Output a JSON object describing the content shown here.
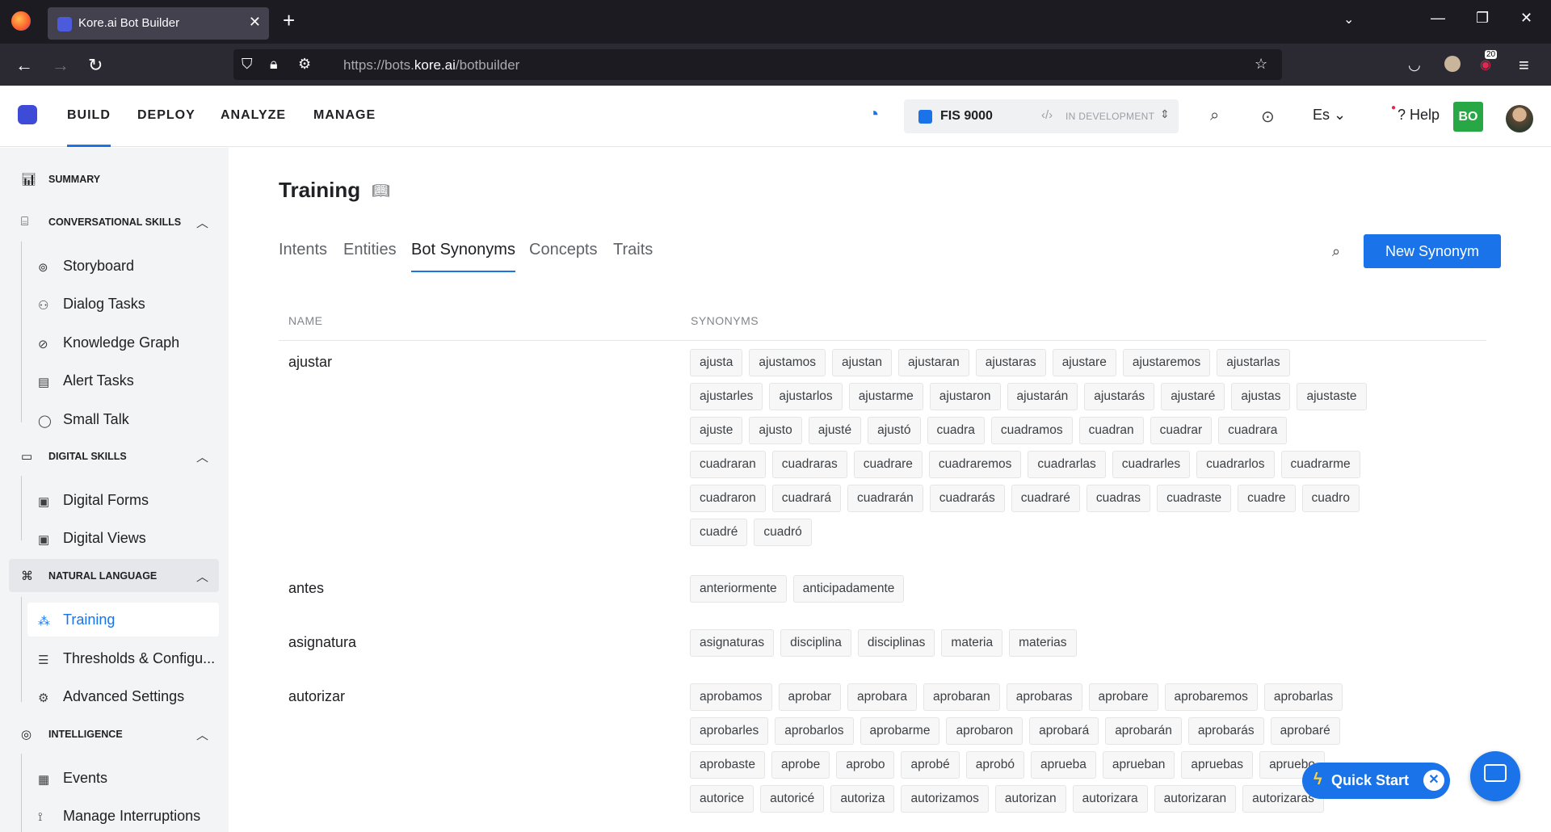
{
  "browser": {
    "tab_title": "Kore.ai Bot Builder",
    "url_prefix": "https://bots.",
    "url_domain": "kore.ai",
    "url_path": "/botbuilder",
    "badge_count": "20"
  },
  "header": {
    "nav": [
      "BUILD",
      "DEPLOY",
      "ANALYZE",
      "MANAGE"
    ],
    "bot_name": "FIS 9000",
    "bot_state": "IN DEVELOPMENT",
    "language": "Es",
    "help": "Help",
    "user_initials": "BO"
  },
  "sidebar": {
    "summary": "SUMMARY",
    "conversational": "CONVERSATIONAL SKILLS",
    "conv_items": [
      "Storyboard",
      "Dialog Tasks",
      "Knowledge Graph",
      "Alert Tasks",
      "Small Talk"
    ],
    "digital": "DIGITAL SKILLS",
    "digital_items": [
      "Digital Forms",
      "Digital Views"
    ],
    "natural": "NATURAL LANGUAGE",
    "nl_items": [
      "Training",
      "Thresholds & Configu...",
      "Advanced Settings"
    ],
    "intelligence": "INTELLIGENCE",
    "int_items": [
      "Events",
      "Manage Interruptions"
    ]
  },
  "main": {
    "title": "Training",
    "tabs": [
      "Intents",
      "Entities",
      "Bot Synonyms",
      "Concepts",
      "Traits"
    ],
    "new_button": "New Synonym",
    "col_name": "NAME",
    "col_synonyms": "SYNONYMS",
    "rows": [
      {
        "name": "ajustar",
        "synonyms": [
          "ajusta",
          "ajustamos",
          "ajustan",
          "ajustaran",
          "ajustaras",
          "ajustare",
          "ajustaremos",
          "ajustarlas",
          "ajustarles",
          "ajustarlos",
          "ajustarme",
          "ajustaron",
          "ajustarán",
          "ajustarás",
          "ajustaré",
          "ajustas",
          "ajustaste",
          "ajuste",
          "ajusto",
          "ajusté",
          "ajustó",
          "cuadra",
          "cuadramos",
          "cuadran",
          "cuadrar",
          "cuadrara",
          "cuadraran",
          "cuadraras",
          "cuadrare",
          "cuadraremos",
          "cuadrarlas",
          "cuadrarles",
          "cuadrarlos",
          "cuadrarme",
          "cuadraron",
          "cuadrará",
          "cuadrarán",
          "cuadrarás",
          "cuadraré",
          "cuadras",
          "cuadraste",
          "cuadre",
          "cuadro",
          "cuadré",
          "cuadró"
        ]
      },
      {
        "name": "antes",
        "synonyms": [
          "anteriormente",
          "anticipadamente"
        ]
      },
      {
        "name": "asignatura",
        "synonyms": [
          "asignaturas",
          "disciplina",
          "disciplinas",
          "materia",
          "materias"
        ]
      },
      {
        "name": "autorizar",
        "synonyms": [
          "aprobamos",
          "aprobar",
          "aprobara",
          "aprobaran",
          "aprobaras",
          "aprobare",
          "aprobaremos",
          "aprobarlas",
          "aprobarles",
          "aprobarlos",
          "aprobarme",
          "aprobaron",
          "aprobará",
          "aprobarán",
          "aprobarás",
          "aprobaré",
          "aprobaste",
          "aprobe",
          "aprobo",
          "aprobé",
          "aprobó",
          "aprueba",
          "aprueban",
          "apruebas",
          "apruebo",
          "autorice",
          "autoricé",
          "autoriza",
          "autorizamos",
          "autorizan",
          "autorizara",
          "autorizaran",
          "autorizaras"
        ]
      }
    ]
  },
  "floating": {
    "quick_start": "Quick Start"
  }
}
